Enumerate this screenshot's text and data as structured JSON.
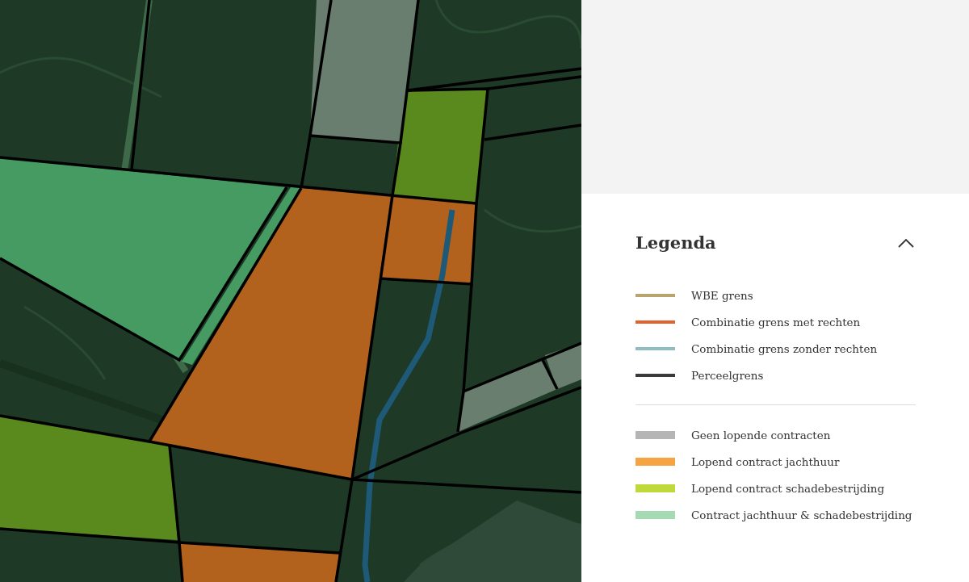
{
  "legend": {
    "title": "Legenda",
    "expanded": true,
    "groups": [
      {
        "items": [
          {
            "kind": "line",
            "label": "WBE grens",
            "color": "#b9a46f"
          },
          {
            "kind": "line",
            "label": "Combinatie grens met rechten",
            "color": "#e0622f"
          },
          {
            "kind": "line",
            "label": "Combinatie grens zonder rechten",
            "color": "#93bcc0"
          },
          {
            "kind": "line",
            "label": "Perceelgrens",
            "color": "#3a3a3a"
          }
        ]
      },
      {
        "items": [
          {
            "kind": "area",
            "label": "Geen lopende contracten",
            "color": "#b5b5b5"
          },
          {
            "kind": "area",
            "label": "Lopend contract jachthuur",
            "color": "#f6a443"
          },
          {
            "kind": "area",
            "label": "Lopend contract schadebestrijding",
            "color": "#c0d93a"
          },
          {
            "kind": "area",
            "label": "Contract jachthuur & schadebestrijding",
            "color": "#a5dbb3"
          }
        ]
      }
    ]
  }
}
